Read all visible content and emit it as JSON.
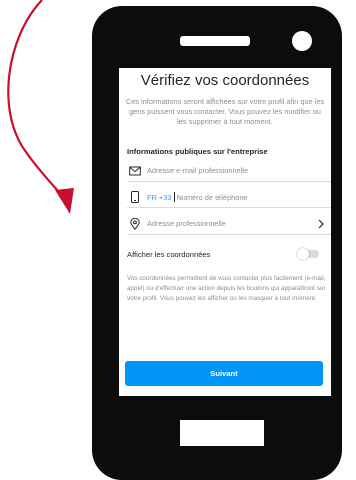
{
  "colors": {
    "arrow": "#c8102e",
    "phone_body": "#0c0c0c",
    "accent": "#0095f6",
    "link": "#3897f0",
    "text_primary": "#262626",
    "text_secondary": "#8e8e8e"
  },
  "screen": {
    "title": "Vérifiez vos coordonnées",
    "subtitle": "Ces informations seront affichées sur votre profil afin que les gens puissent vous contacter. Vous pouvez les modifier ou les supprimer à tout moment.",
    "section_title": "Informations publiques sur l'entreprise",
    "email_field": {
      "icon": "envelope-icon",
      "placeholder": "Adresse e-mail professionnelle"
    },
    "phone_field": {
      "icon": "phone-icon",
      "country_code": "FR +33",
      "placeholder": "Numéro de téléphone"
    },
    "address_field": {
      "icon": "location-pin-icon",
      "placeholder": "Adresse professionnelle"
    },
    "toggle": {
      "label": "Afficher les coordonnées",
      "on": false
    },
    "description": "Vos coordonnées permettent de vous contacter plus facilement (e-mail, appel) ou d'effectuer une action depuis les boutons qui apparaîtront sur votre profil. Vous pouvez les afficher ou les masquer à tout moment.",
    "submit_label": "Suivant"
  }
}
